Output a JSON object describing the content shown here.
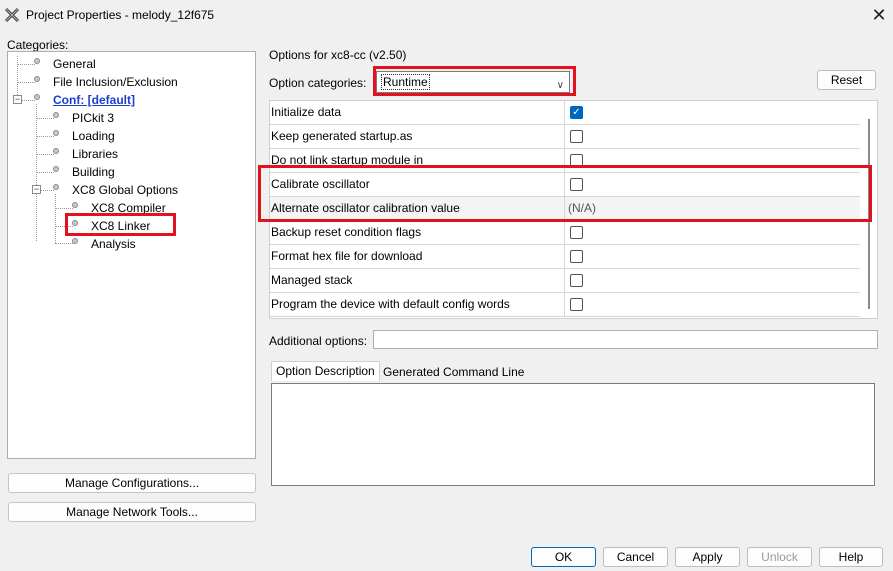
{
  "window": {
    "title": "Project Properties - melody_12f675",
    "close": "✕"
  },
  "categories": {
    "label": "Categories:",
    "items": [
      {
        "label": "General"
      },
      {
        "label": "File Inclusion/Exclusion"
      },
      {
        "label": "Conf: [default]"
      },
      {
        "label": "PICkit 3"
      },
      {
        "label": "Loading"
      },
      {
        "label": "Libraries"
      },
      {
        "label": "Building"
      },
      {
        "label": "XC8 Global Options"
      },
      {
        "label": "XC8 Compiler"
      },
      {
        "label": "XC8 Linker"
      },
      {
        "label": "Analysis"
      }
    ]
  },
  "side_buttons": {
    "manage_configurations": "Manage Configurations...",
    "manage_network_tools": "Manage Network Tools..."
  },
  "options": {
    "options_for": "Options for xc8-cc (v2.50)",
    "category_label": "Option categories:",
    "category_value": "Runtime",
    "reset": "Reset",
    "rows": [
      {
        "name": "Initialize data",
        "checked": true
      },
      {
        "name": "Keep generated startup.as",
        "checked": false
      },
      {
        "name": "Do not link startup module in",
        "checked": false
      },
      {
        "name": "Calibrate oscillator",
        "checked": false
      },
      {
        "name": "Alternate oscillator calibration value",
        "value": "(N/A)"
      },
      {
        "name": "Backup reset condition flags",
        "checked": false
      },
      {
        "name": "Format hex file for download",
        "checked": false
      },
      {
        "name": "Managed stack",
        "checked": false
      },
      {
        "name": "Program the device with default config words",
        "checked": false
      }
    ],
    "additional_label": "Additional options:",
    "additional_value": ""
  },
  "tabs": {
    "description": "Option Description",
    "command_line": "Generated Command Line"
  },
  "buttons": {
    "ok": "OK",
    "cancel": "Cancel",
    "apply": "Apply",
    "unlock": "Unlock",
    "help": "Help"
  },
  "colors": {
    "highlight_box": "#e3101d",
    "checkbox_checked": "#0067c0",
    "link": "#1a3fd0"
  }
}
